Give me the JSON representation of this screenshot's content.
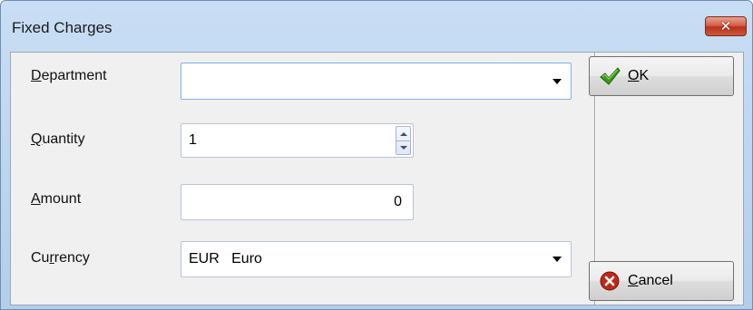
{
  "window": {
    "title": "Fixed Charges",
    "close_glyph": "✕"
  },
  "form": {
    "department": {
      "label_mnemonic": "D",
      "label_rest": "epartment",
      "value": ""
    },
    "quantity": {
      "label_mnemonic": "Q",
      "label_rest": "uantity",
      "value": "1"
    },
    "amount": {
      "label_mnemonic": "A",
      "label_rest": "mount",
      "value": "0"
    },
    "currency": {
      "label_prefix": "Cu",
      "label_mnemonic": "r",
      "label_rest": "rency",
      "value": "EUR   Euro"
    }
  },
  "buttons": {
    "ok": {
      "label_mnemonic": "O",
      "label_rest": "K",
      "icon": "checkmark-icon",
      "icon_color": "#3b9b1a"
    },
    "cancel": {
      "label_mnemonic": "C",
      "label_rest": "ancel",
      "icon": "cancel-icon",
      "icon_color": "#c0281c"
    }
  },
  "colors": {
    "titlebar": "#c9def5",
    "close_button": "#c8452a",
    "focus_border": "#7eb4ea"
  }
}
